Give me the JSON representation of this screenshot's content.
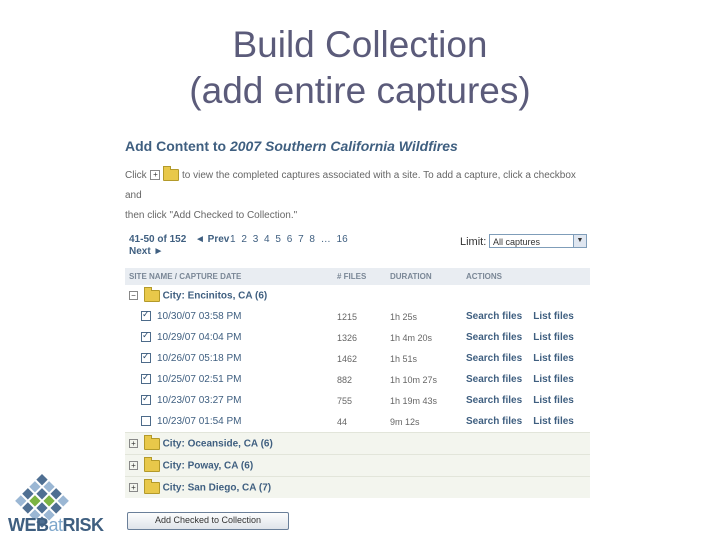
{
  "slide": {
    "title_line1": "Build Collection",
    "title_line2": "(add entire captures)"
  },
  "panel": {
    "heading_prefix": "Add Content to",
    "collection_name": "2007 Southern California Wildfires",
    "instructions_part1": "Click",
    "instructions_part2": "to view the completed captures associated with a site. To add a capture, click a checkbox and",
    "instructions_line2": "then click \"Add Checked to Collection.\""
  },
  "pager": {
    "range": "41-50 of 152",
    "prev_label": "◄ Prev",
    "pages": [
      "1",
      "2",
      "3",
      "4",
      "5",
      "6",
      "7",
      "8",
      "…",
      "16"
    ],
    "next_label": "Next ►",
    "limit_label": "Limit:",
    "limit_value": "All captures"
  },
  "table": {
    "headers": {
      "site": "SITE NAME / CAPTURE DATE",
      "files": "# FILES",
      "duration": "DURATION",
      "actions": "ACTIONS"
    },
    "expanded_city": {
      "toggle": "−",
      "name": "City: Encinitos, CA",
      "count": "(6)"
    },
    "captures": [
      {
        "date": "10/30/07 03:58 PM",
        "files": "1215",
        "duration": "1h 25s",
        "checked": true
      },
      {
        "date": "10/29/07 04:04 PM",
        "files": "1326",
        "duration": "1h 4m 20s",
        "checked": true
      },
      {
        "date": "10/26/07 05:18 PM",
        "files": "1462",
        "duration": "1h 51s",
        "checked": true
      },
      {
        "date": "10/25/07 02:51 PM",
        "files": "882",
        "duration": "1h 10m 27s",
        "checked": true
      },
      {
        "date": "10/23/07 03:27 PM",
        "files": "755",
        "duration": "1h 19m 43s",
        "checked": true
      },
      {
        "date": "10/23/07 01:54 PM",
        "files": "44",
        "duration": "9m 12s",
        "checked": false
      }
    ],
    "action_search": "Search files",
    "action_list": "List files",
    "collapsed_cities": [
      {
        "toggle": "+",
        "name": "City: Oceanside, CA",
        "count": "(6)"
      },
      {
        "toggle": "+",
        "name": "City: Poway, CA",
        "count": "(6)"
      },
      {
        "toggle": "+",
        "name": "City: San Diego, CA",
        "count": "(7)"
      }
    ]
  },
  "add_button_label": "Add Checked to Collection",
  "logo": {
    "text_part1": "WEB",
    "text_part2": "at",
    "text_part3": "RISK"
  },
  "icons": {
    "expand": "plus-box-icon",
    "folder": "folder-icon",
    "logo_mark": "woven-grid-logo-icon"
  },
  "colors": {
    "link_blue": "#3f5f80",
    "title_gray": "#5b5b7a",
    "header_bg": "#e9edf2"
  }
}
